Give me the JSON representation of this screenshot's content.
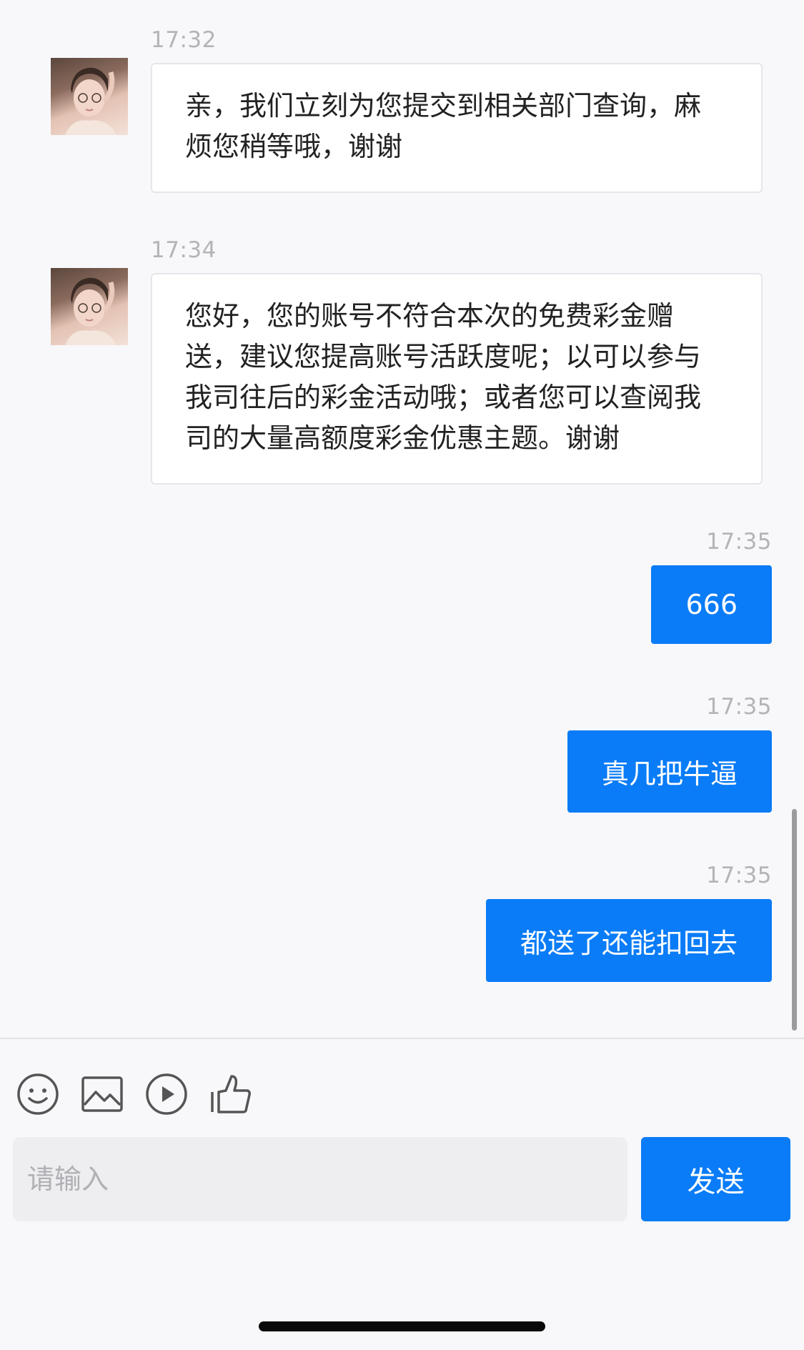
{
  "messages": [
    {
      "time": "17:32",
      "from": "agent",
      "text": "亲，我们立刻为您提交到相关部门查询，麻\n烦您稍等哦，谢谢"
    },
    {
      "time": "17:34",
      "from": "agent",
      "text": "您好，您的账号不符合本次的免费彩金赠\n送，建议您提高账号活跃度呢；以可以参与\n我司往后的彩金活动哦；或者您可以查阅我\n司的大量高额度彩金优惠主题。谢谢"
    },
    {
      "time": "17:35",
      "from": "user",
      "text": "666"
    },
    {
      "time": "17:35",
      "from": "user",
      "text": "真几把牛逼"
    },
    {
      "time": "17:35",
      "from": "user",
      "text": "都送了还能扣回去"
    }
  ],
  "toolbar": {
    "icons": [
      "emoji-icon",
      "image-icon",
      "video-play-icon",
      "thumbs-up-icon"
    ]
  },
  "input": {
    "placeholder": "请输入",
    "value": ""
  },
  "send_label": "发送",
  "colors": {
    "accent": "#0a7cf7",
    "background": "#f8f8fa",
    "timestamp": "#b3b3b8"
  }
}
